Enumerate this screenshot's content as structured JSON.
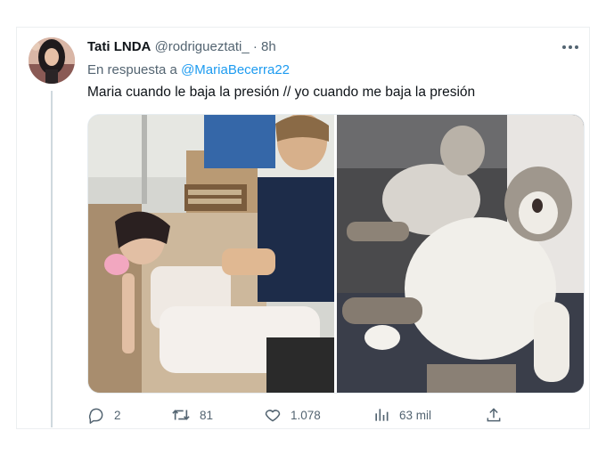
{
  "tweet": {
    "author_name": "Tati LNDA",
    "author_handle": "@rodrigueztati_",
    "separator": "·",
    "time": "8h",
    "reply_prefix": "En respuesta a",
    "reply_to": "@MariaBecerra22",
    "text": "Maria cuando le baja la presión // yo cuando me baja la presión"
  },
  "media": {
    "left_image": "photo-woman-lying-down-with-fan",
    "right_image": "photo-cat-lying-on-back"
  },
  "actions": {
    "replies": "2",
    "retweets": "81",
    "likes": "1.078",
    "views": "63 mil"
  },
  "icons": {
    "more": "more-dots-icon",
    "reply": "reply-icon",
    "retweet": "retweet-icon",
    "like": "heart-icon",
    "views": "views-chart-icon",
    "share": "share-icon"
  },
  "colors": {
    "link": "#1d9bf0",
    "secondary_text": "#536471",
    "primary_text": "#0f1419"
  }
}
